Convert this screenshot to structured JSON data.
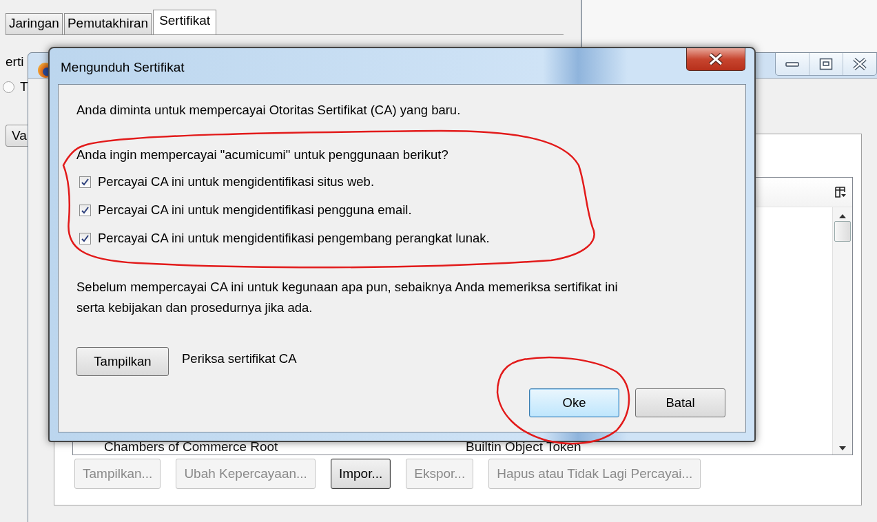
{
  "options_window": {
    "tabs": [
      {
        "label": "Jaringan",
        "selected": false
      },
      {
        "label": "Pemutakhiran",
        "selected": false
      },
      {
        "label": "Sertifikat",
        "selected": true
      }
    ],
    "label_fragment": "erti",
    "radio": {
      "label": "T",
      "selected": false
    },
    "button": {
      "label": "Va"
    }
  },
  "manager_window": {
    "rows": [
      {
        "cells": [
          "Chambers of Commerce Root",
          "Builtin Object Token"
        ]
      }
    ],
    "buttons": [
      {
        "label": "Tampilkan...",
        "disabled": true,
        "default": false
      },
      {
        "label": "Ubah Kepercayaan...",
        "disabled": true,
        "default": false
      },
      {
        "label": "Impor...",
        "disabled": false,
        "default": true
      },
      {
        "label": "Ekspor...",
        "disabled": true,
        "default": false
      },
      {
        "label": "Hapus atau Tidak Lagi Percayai...",
        "disabled": true,
        "default": false
      }
    ]
  },
  "dialog": {
    "title": "Mengunduh Sertifikat",
    "intro": "Anda diminta untuk mempercayai Otoritas Sertifikat (CA) yang baru.",
    "question": "Anda ingin mempercayai \"acumicumi\" untuk penggunaan berikut?",
    "checkboxes": [
      {
        "label": "Percayai CA ini untuk mengidentifikasi situs web.",
        "checked": true
      },
      {
        "label": "Percayai CA ini untuk mengidentifikasi pengguna email.",
        "checked": true
      },
      {
        "label": "Percayai CA ini untuk mengidentifikasi pengembang perangkat lunak.",
        "checked": true
      }
    ],
    "note": "Sebelum mempercayai CA ini untuk kegunaan apa pun, sebaiknya Anda memeriksa sertifikat ini serta kebijakan dan prosedurnya jika ada.",
    "view_button": "Tampilkan",
    "view_label": "Periksa sertifikat CA",
    "buttons": [
      {
        "label": "Oke",
        "default": true
      },
      {
        "label": "Batal",
        "default": false
      }
    ]
  }
}
